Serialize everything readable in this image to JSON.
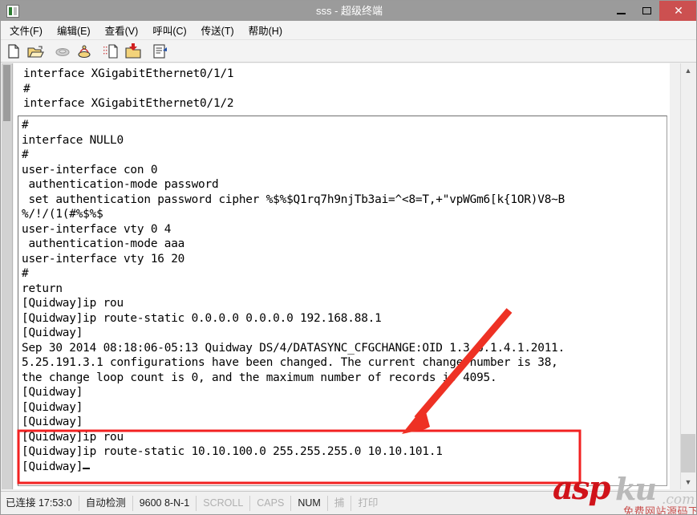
{
  "window": {
    "title": "sss - 超级终端",
    "icon": "terminal-icon",
    "controls": {
      "minimize": "–",
      "maximize": "❐",
      "close": "✕"
    }
  },
  "menubar": {
    "items": [
      {
        "label": "文件(F)",
        "name": "menu-file"
      },
      {
        "label": "编辑(E)",
        "name": "menu-edit"
      },
      {
        "label": "查看(V)",
        "name": "menu-view"
      },
      {
        "label": "呼叫(C)",
        "name": "menu-call"
      },
      {
        "label": "传送(T)",
        "name": "menu-transfer"
      },
      {
        "label": "帮助(H)",
        "name": "menu-help"
      }
    ]
  },
  "toolbar": {
    "buttons": [
      {
        "icon": "new-document-icon",
        "title": "新建"
      },
      {
        "icon": "open-folder-icon",
        "title": "打开"
      },
      {
        "icon": "disconnect-phone-icon",
        "title": "断开"
      },
      {
        "icon": "connect-phone-icon",
        "title": "呼叫"
      },
      {
        "icon": "send-file-icon",
        "title": "发送"
      },
      {
        "icon": "receive-file-icon",
        "title": "接收"
      },
      {
        "icon": "properties-icon",
        "title": "属性"
      }
    ]
  },
  "terminal": {
    "top_lines": [
      "interface XGigabitEthernet0/1/1",
      "#",
      "interface XGigabitEthernet0/1/2"
    ],
    "lines": [
      "#",
      "interface NULL0",
      "#",
      "user-interface con 0",
      " authentication-mode password",
      " set authentication password cipher %$%$Q1rq7h9njTb3ai=^<8=T,+\"vpWGm6[k{1OR)V8~B",
      "%/!/(1(#%$%$",
      "user-interface vty 0 4",
      " authentication-mode aaa",
      "user-interface vty 16 20",
      "#",
      "return",
      "[Quidway]ip rou",
      "[Quidway]ip route-static 0.0.0.0 0.0.0.0 192.168.88.1",
      "[Quidway]",
      "Sep 30 2014 08:18:06-05:13 Quidway DS/4/DATASYNC_CFGCHANGE:OID 1.3.6.1.4.1.2011.",
      "5.25.191.3.1 configurations have been changed. The current change number is 38,",
      "the change loop count is 0, and the maximum number of records is 4095.",
      "[Quidway]",
      "[Quidway]",
      "[Quidway]",
      "[Quidway]ip rou",
      "[Quidway]ip route-static 10.10.100.0 255.255.255.0 10.10.101.1",
      "[Quidway]"
    ],
    "cursor": "_"
  },
  "annotations": {
    "highlight_box_color": "#f22121",
    "arrow_color": "#ee3124"
  },
  "statusbar": {
    "cells": [
      {
        "label": "已连接 17:53:0",
        "name": "status-connected",
        "dim": false
      },
      {
        "label": "自动检测",
        "name": "status-autodetect",
        "dim": false
      },
      {
        "label": "9600 8-N-1",
        "name": "status-serial-settings",
        "dim": false
      },
      {
        "label": "SCROLL",
        "name": "status-scroll",
        "dim": true
      },
      {
        "label": "CAPS",
        "name": "status-caps",
        "dim": true
      },
      {
        "label": "NUM",
        "name": "status-num",
        "dim": false
      },
      {
        "label": "捕",
        "name": "status-capture",
        "dim": true
      },
      {
        "label": "打印",
        "name": "status-print",
        "dim": true
      }
    ]
  },
  "watermark": {
    "asp": "asp",
    "ku": "ku",
    "com": ".com",
    "subtitle": "免费网站源码下载站"
  }
}
